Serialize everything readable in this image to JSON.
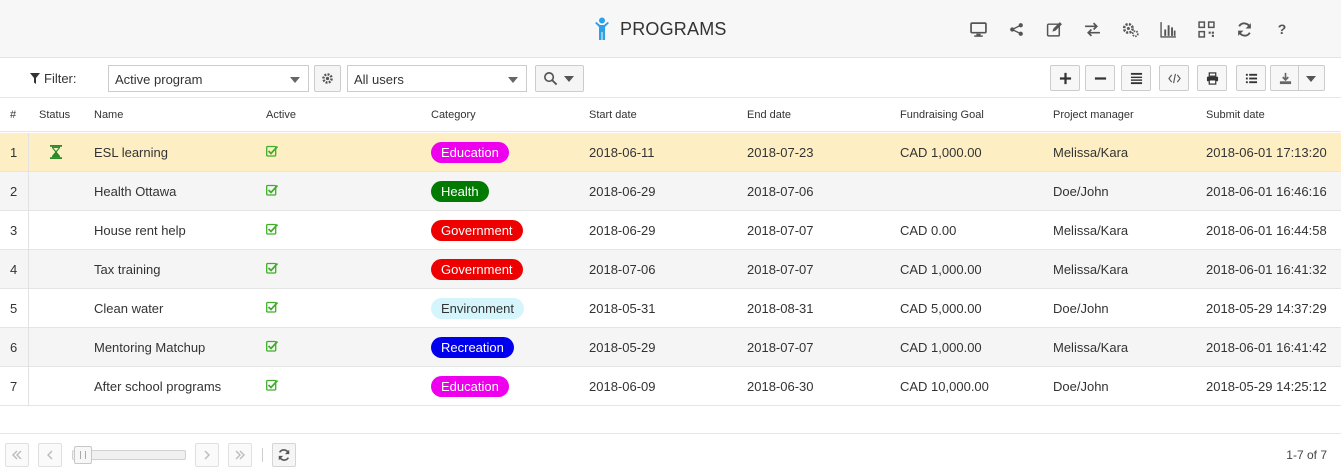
{
  "header": {
    "title": "PROGRAMS",
    "icons": [
      "monitor-icon",
      "share-icon",
      "edit-icon",
      "swap-icon",
      "settings-icon",
      "chart-icon",
      "qrcode-icon",
      "refresh-icon",
      "help-icon"
    ],
    "help_glyph": "?"
  },
  "toolbar": {
    "filter_label": "Filter:",
    "filter_select": "Active program",
    "user_select": "All users",
    "right_buttons": [
      "add-icon",
      "remove-icon",
      "columns-icon",
      "code-icon",
      "print-icon",
      "list-icon",
      "download-icon"
    ]
  },
  "table": {
    "columns": [
      "#",
      "Status",
      "Name",
      "Active",
      "Category",
      "Start date",
      "End date",
      "Fundraising Goal",
      "Project manager",
      "Submit date"
    ],
    "rows": [
      {
        "num": "1",
        "status": "pending",
        "name": "ESL learning",
        "active": true,
        "category": "Education",
        "start": "2018-06-11",
        "end": "2018-07-23",
        "goal": "CAD 1,000.00",
        "manager": "Melissa/Kara",
        "submit": "2018-06-01 17:13:20"
      },
      {
        "num": "2",
        "status": "",
        "name": "Health Ottawa",
        "active": true,
        "category": "Health",
        "start": "2018-06-29",
        "end": "2018-07-06",
        "goal": "",
        "manager": "Doe/John",
        "submit": "2018-06-01 16:46:16"
      },
      {
        "num": "3",
        "status": "",
        "name": "House rent help",
        "active": true,
        "category": "Government",
        "start": "2018-06-29",
        "end": "2018-07-07",
        "goal": "CAD 0.00",
        "manager": "Melissa/Kara",
        "submit": "2018-06-01 16:44:58"
      },
      {
        "num": "4",
        "status": "",
        "name": "Tax training",
        "active": true,
        "category": "Government",
        "start": "2018-07-06",
        "end": "2018-07-07",
        "goal": "CAD 1,000.00",
        "manager": "Melissa/Kara",
        "submit": "2018-06-01 16:41:32"
      },
      {
        "num": "5",
        "status": "",
        "name": "Clean water",
        "active": true,
        "category": "Environment",
        "start": "2018-05-31",
        "end": "2018-08-31",
        "goal": "CAD 5,000.00",
        "manager": "Doe/John",
        "submit": "2018-05-29 14:37:29"
      },
      {
        "num": "6",
        "status": "",
        "name": "Mentoring Matchup",
        "active": true,
        "category": "Recreation",
        "start": "2018-05-29",
        "end": "2018-07-07",
        "goal": "CAD 1,000.00",
        "manager": "Melissa/Kara",
        "submit": "2018-06-01 16:41:42"
      },
      {
        "num": "7",
        "status": "",
        "name": "After school programs",
        "active": true,
        "category": "Education",
        "start": "2018-06-09",
        "end": "2018-06-30",
        "goal": "CAD 10,000.00",
        "manager": "Doe/John",
        "submit": "2018-05-29 14:25:12"
      }
    ]
  },
  "category_colors": {
    "Education": {
      "bg": "#ee00ee",
      "fg": "#ffffff"
    },
    "Health": {
      "bg": "#007a00",
      "fg": "#ffffff"
    },
    "Government": {
      "bg": "#ee0000",
      "fg": "#ffffff"
    },
    "Environment": {
      "bg": "#d4f5fb",
      "fg": "#333333"
    },
    "Recreation": {
      "bg": "#0000ee",
      "fg": "#ffffff"
    }
  },
  "colors": {
    "selected_row": "#fdefc3",
    "check": "#3fae29",
    "status_icon": "#2a8a2a",
    "title_icon": "#2ea0e8"
  },
  "pager": {
    "info": "1-7 of 7"
  }
}
